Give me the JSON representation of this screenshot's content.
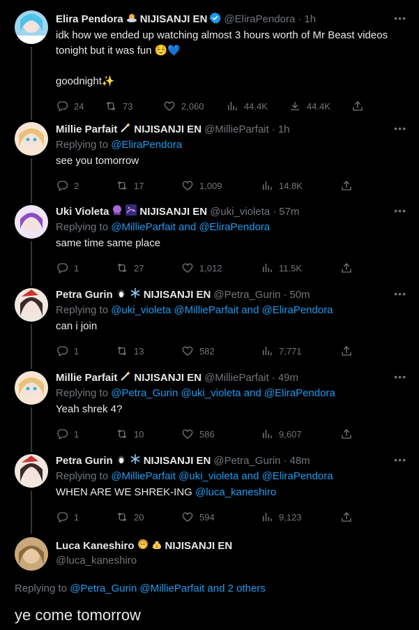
{
  "tweets": [
    {
      "name": "Elira Pendora",
      "org": "NIJISANJI EN",
      "handle": "@EliraPendora",
      "time": "1h",
      "verified": true,
      "reply_to_prefix": "",
      "reply_to_mentions": "",
      "body": "idk how we ended up watching almost 3 hours worth of Mr Beast videos tonight but it was fun ☺️💙\n\ngoodnight✨",
      "replies": "24",
      "retweets": "73",
      "likes": "2,060",
      "views": "44.4K",
      "downloads": "44.4K"
    },
    {
      "name": "Millie Parfait",
      "org": "NIJISANJI EN",
      "handle": "@MillieParfait",
      "time": "1h",
      "reply_to_prefix": "Replying to ",
      "reply_to_mentions": "@EliraPendora",
      "body": "see you tomorrow",
      "replies": "2",
      "retweets": "17",
      "likes": "1,009",
      "views": "14.8K"
    },
    {
      "name": "Uki Violeta",
      "org": "NIJISANJI EN",
      "handle": "@uki_violeta",
      "time": "57m",
      "reply_to_prefix": "Replying to ",
      "reply_to_mentions": "@MillieParfait and @EliraPendora",
      "body": "same time same place",
      "replies": "1",
      "retweets": "27",
      "likes": "1,012",
      "views": "11.5K"
    },
    {
      "name": "Petra Gurin",
      "org": "NIJISANJI EN",
      "handle": "@Petra_Gurin",
      "time": "50m",
      "reply_to_prefix": "Replying to ",
      "reply_to_mentions": "@uki_violeta @MillieParfait and @EliraPendora",
      "body": "can i join",
      "replies": "1",
      "retweets": "13",
      "likes": "582",
      "views": "7,771"
    },
    {
      "name": "Millie Parfait",
      "org": "NIJISANJI EN",
      "handle": "@MillieParfait",
      "time": "49m",
      "reply_to_prefix": "Replying to ",
      "reply_to_mentions": "@Petra_Gurin @uki_violeta and @EliraPendora",
      "body": "Yeah shrek 4?",
      "replies": "1",
      "retweets": "10",
      "likes": "586",
      "views": "9,607"
    },
    {
      "name": "Petra Gurin",
      "org": "NIJISANJI EN",
      "handle": "@Petra_Gurin",
      "time": "48m",
      "reply_to_prefix": "Replying to ",
      "reply_to_mentions": "@MillieParfait @uki_violeta and @EliraPendora",
      "body_text": "WHEN ARE WE SHREK-ING ",
      "body_mention": "@luca_kaneshiro",
      "replies": "1",
      "retweets": "20",
      "likes": "594",
      "views": "9,123"
    }
  ],
  "focus": {
    "name": "Luca Kaneshiro",
    "org": "NIJISANJI EN",
    "handle": "@luca_kaneshiro",
    "reply_to_prefix": "Replying to ",
    "reply_to_mentions": "@Petra_Gurin @MillieParfait and 2 others",
    "body": "ye come tomorrow"
  },
  "icons": {
    "more": "more-icon",
    "reply": "reply-icon",
    "retweet": "retweet-icon",
    "like": "like-icon",
    "views": "views-icon",
    "download": "download-icon",
    "share": "share-icon",
    "verified": "verified-icon"
  },
  "colors": {
    "background": "#000000",
    "text": "#e7e9ea",
    "muted": "#71767b",
    "accent": "#1d9bf0",
    "line": "#333639"
  }
}
